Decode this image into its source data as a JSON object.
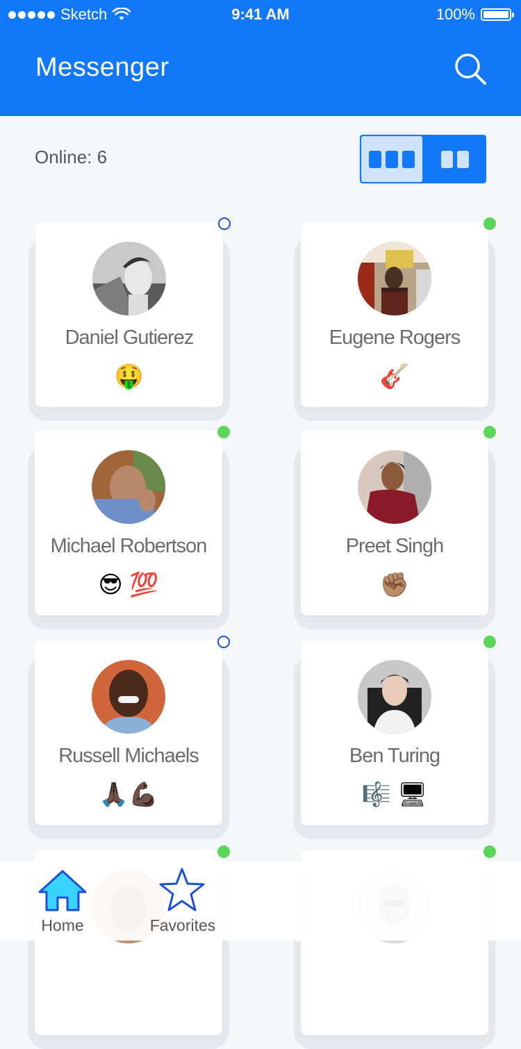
{
  "status_bar": {
    "carrier": "Sketch",
    "time": "9:41 AM",
    "battery": "100%"
  },
  "header": {
    "title": "Messenger",
    "search_icon": "search-icon"
  },
  "toolbar": {
    "online_label": "Online: 6",
    "view_toggle": [
      "three-column-view",
      "two-column-view"
    ],
    "selected_view": "three-column-view"
  },
  "contacts": [
    {
      "name": "Daniel Gutierez",
      "emoji": "🤑",
      "online": false
    },
    {
      "name": "Eugene Rogers",
      "emoji": "🎸",
      "online": true
    },
    {
      "name": "Michael Robertson",
      "emoji": "😎 💯",
      "online": true
    },
    {
      "name": "Preet Singh",
      "emoji": "✊🏽",
      "online": true
    },
    {
      "name": "Russell Michaels",
      "emoji": "🙏🏿💪🏿",
      "online": false
    },
    {
      "name": "Ben Turing",
      "emoji": "🎼 🖥",
      "online": true
    },
    {
      "name": "",
      "emoji": "",
      "online": true
    },
    {
      "name": "",
      "emoji": "",
      "online": true
    }
  ],
  "tabbar": {
    "home_label": "Home",
    "favorites_label": "Favorites"
  },
  "colors": {
    "primary": "#1278f7",
    "online": "#5bd65a",
    "offline_ring": "#1f4fcf",
    "background": "#f6f7fa"
  }
}
